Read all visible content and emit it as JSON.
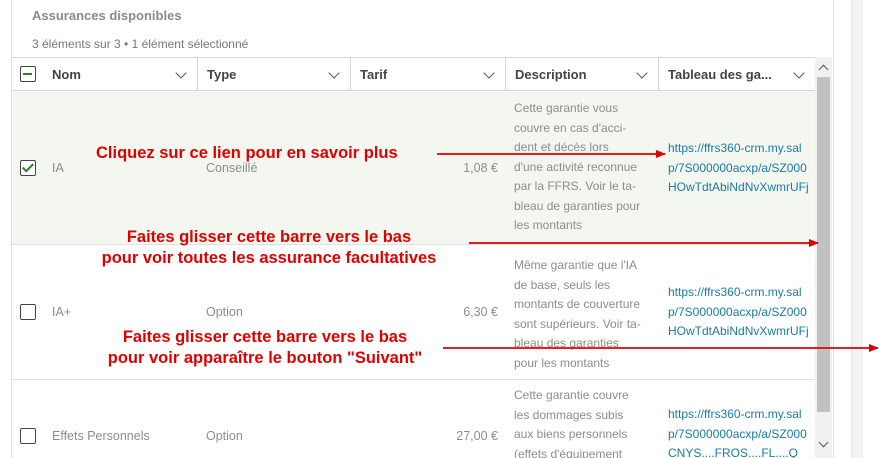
{
  "card": {
    "title": "Assurances disponibles",
    "subtitle": "3 éléments sur 3 • 1 élément sélectionné"
  },
  "columns": [
    {
      "key": "nom",
      "label": "Nom"
    },
    {
      "key": "type",
      "label": "Type"
    },
    {
      "key": "tarif",
      "label": "Tarif"
    },
    {
      "key": "description",
      "label": "Description"
    },
    {
      "key": "tableau",
      "label": "Tableau des ga..."
    }
  ],
  "select_all": {
    "state": "partial"
  },
  "rows": [
    {
      "selected": true,
      "nom": "IA",
      "type": "Conseillé",
      "tarif": "1,08 €",
      "description": [
        "Cette garantie vous",
        "couvre en cas d'acci-",
        "dent et décès lors",
        "d'une activité reconnue",
        "par la FFRS. Voir le ta-",
        "bleau de garanties pour",
        "les montants"
      ],
      "link": [
        "https://ffrs360-crm.my.sal",
        "p/7S000000acxp/a/SZ000",
        "HOwTdtAbiNdNvXwmrUFj"
      ]
    },
    {
      "selected": false,
      "nom": "IA+",
      "type": "Option",
      "tarif": "6,30 €",
      "description": [
        "Même garantie que l'IA",
        "de base, seuls les",
        "montants de couverture",
        "sont supérieurs. Voir ta-",
        "bleau des garanties",
        "pour les montants"
      ],
      "link": [
        "https://ffrs360-crm.my.sal",
        "p/7S000000acxp/a/SZ000",
        "HOwTdtAbiNdNvXwmrUFj"
      ]
    },
    {
      "selected": false,
      "nom": "Effets Personnels",
      "type": "Option",
      "tarif": "27,00 €",
      "description": [
        "Cette garantie couvre",
        "les dommages subis",
        "aux biens personnels",
        "(effets d'équipement"
      ],
      "link": [
        "https://ffrs360-crm.my.sal",
        "p/7S000000acxp/a/SZ000",
        "CNYS....FROS....FL....Q"
      ]
    }
  ],
  "annotations": {
    "link_hint": "Cliquez sur ce lien pour en savoir plus",
    "scroll_hint_1_line1": "Faites glisser cette barre vers le bas",
    "scroll_hint_1_line2": "pour voir toutes les assurance facultatives",
    "scroll_hint_2_line1": "Faites glisser cette barre vers le bas",
    "scroll_hint_2_line2": "pour voir apparaître le bouton \"Suivant\""
  },
  "colors": {
    "annotation": "#e00000",
    "link": "#1a7aa5",
    "selected_row": "#f3f7ef",
    "check": "#2e7d32"
  }
}
